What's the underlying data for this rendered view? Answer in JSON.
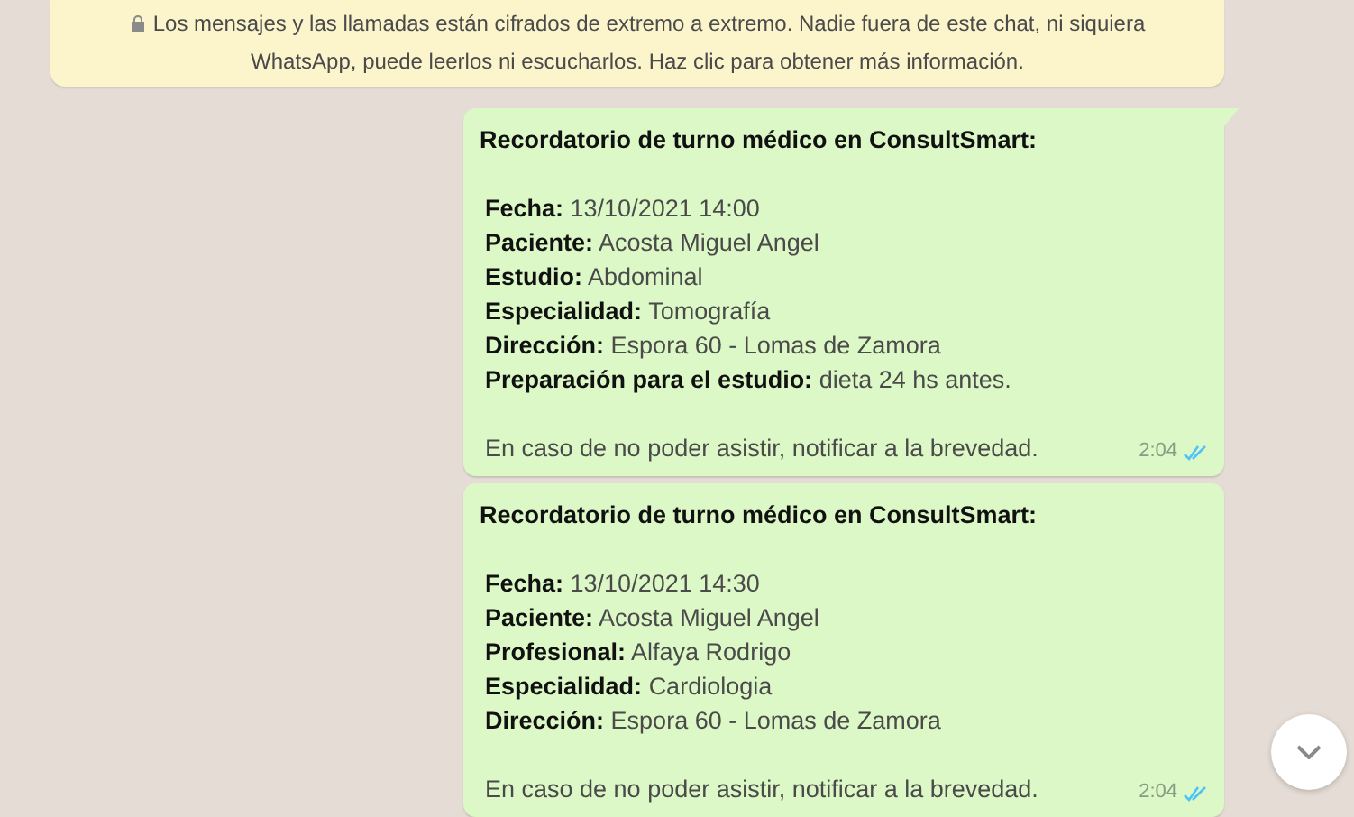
{
  "encryption_notice": {
    "text": "Los mensajes y las llamadas están cifrados de extremo a extremo. Nadie fuera de este chat, ni siquiera WhatsApp, puede leerlos ni escucharlos. Haz clic para obtener más información."
  },
  "messages": [
    {
      "tail": true,
      "title": "Recordatorio de turno médico en ConsultSmart:",
      "fields": [
        {
          "label": "Fecha:",
          "value": "13/10/2021 14:00"
        },
        {
          "label": "Paciente:",
          "value": "Acosta Miguel Angel"
        },
        {
          "label": "Estudio:",
          "value": "Abdominal"
        },
        {
          "label": "Especialidad:",
          "value": "Tomografía"
        },
        {
          "label": "Dirección:",
          "value": "Espora 60 - Lomas de Zamora"
        },
        {
          "label": "Preparación para el estudio:",
          "value": "dieta 24 hs antes."
        }
      ],
      "footer": "En caso de no poder asistir, notificar a la brevedad.",
      "time": "2:04",
      "read": true
    },
    {
      "tail": false,
      "title": "Recordatorio de turno médico en ConsultSmart:",
      "fields": [
        {
          "label": "Fecha:",
          "value": "13/10/2021 14:30"
        },
        {
          "label": "Paciente:",
          "value": "Acosta Miguel Angel"
        },
        {
          "label": "Profesional:",
          "value": "Alfaya Rodrigo"
        },
        {
          "label": "Especialidad:",
          "value": "Cardiologia"
        },
        {
          "label": "Dirección:",
          "value": "Espora 60 - Lomas de Zamora"
        }
      ],
      "footer": "En caso de no poder asistir, notificar a la brevedad.",
      "time": "2:04",
      "read": true
    }
  ]
}
